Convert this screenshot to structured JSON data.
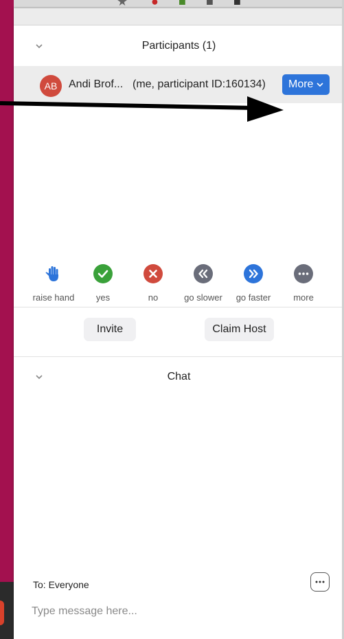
{
  "participants_section": {
    "title": "Participants (1)",
    "participant": {
      "initials": "AB",
      "name": "Andi Brof...",
      "detail": "(me, participant ID:160134)",
      "more_label": "More"
    }
  },
  "reactions": [
    {
      "label": "raise hand",
      "icon": "raised-hand-icon",
      "color": "#2d74da"
    },
    {
      "label": "yes",
      "icon": "check-icon",
      "color": "#3aa13a"
    },
    {
      "label": "no",
      "icon": "x-icon",
      "color": "#d04a3d"
    },
    {
      "label": "go slower",
      "icon": "rewind-icon",
      "color": "#6a6d7a"
    },
    {
      "label": "go faster",
      "icon": "fast-forward-icon",
      "color": "#2d74da"
    },
    {
      "label": "more",
      "icon": "ellipsis-icon",
      "color": "#6a6d7a"
    }
  ],
  "actions": {
    "invite_label": "Invite",
    "claim_host_label": "Claim Host"
  },
  "chat_section": {
    "title": "Chat",
    "to_label": "To: Everyone",
    "input_placeholder": "Type message here..."
  },
  "colors": {
    "accent": "#2d74da",
    "background": "#a3114f",
    "avatar": "#d04a3d"
  }
}
